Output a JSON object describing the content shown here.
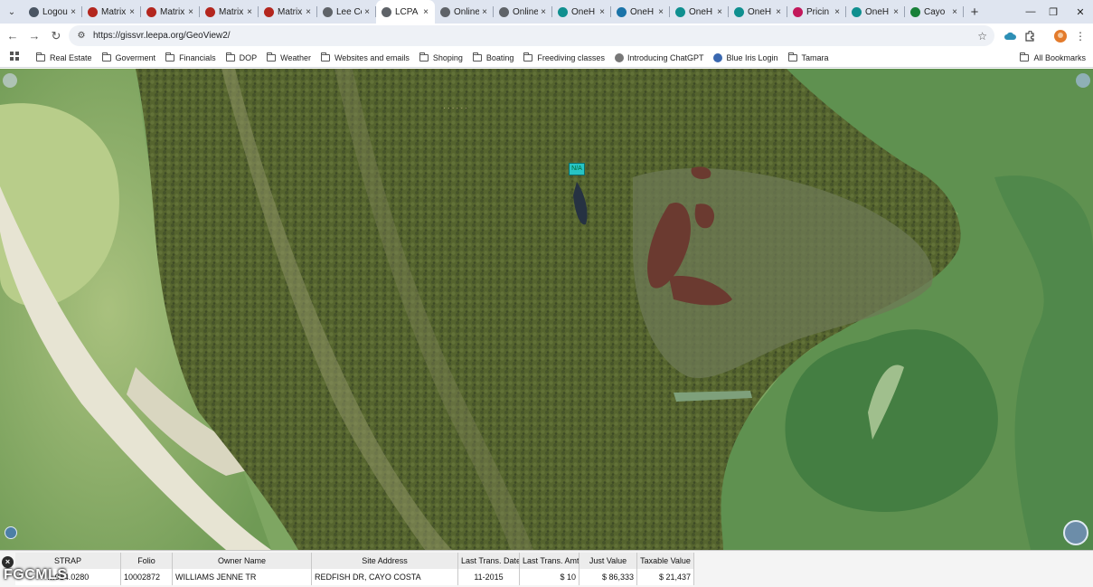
{
  "browser": {
    "tabs": [
      {
        "label": "Logou",
        "color": "#4a5563"
      },
      {
        "label": "Matrix",
        "color": "#b3261e"
      },
      {
        "label": "Matrix",
        "color": "#b3261e"
      },
      {
        "label": "Matrix",
        "color": "#b3261e"
      },
      {
        "label": "Matrix",
        "color": "#b3261e"
      },
      {
        "label": "Lee Co",
        "color": "#5f6368"
      },
      {
        "label": "LCPA",
        "color": "#5f6368",
        "active": true
      },
      {
        "label": "Online",
        "color": "#5f6368"
      },
      {
        "label": "Online",
        "color": "#5f6368"
      },
      {
        "label": "OneH",
        "color": "#0f8f8f"
      },
      {
        "label": "OneH",
        "color": "#1a73a8"
      },
      {
        "label": "OneH",
        "color": "#0f8f8f"
      },
      {
        "label": "OneH",
        "color": "#0f8f8f"
      },
      {
        "label": "Pricin",
        "color": "#c2185b"
      },
      {
        "label": "OneH",
        "color": "#0f8f8f"
      },
      {
        "label": "Cayo",
        "color": "#188038"
      }
    ],
    "close_glyph": "×",
    "new_tab_glyph": "+",
    "window_controls": {
      "minimize": "—",
      "restore": "❐",
      "close": "✕"
    },
    "url": "https://gissvr.leepa.org/GeoView2/"
  },
  "bookmarks": {
    "items": [
      "Real Estate",
      "Goverment",
      "Financials",
      "DOP",
      "Weather",
      "Websites and emails",
      "Shoping",
      "Boating",
      "Freediving classes",
      "Introducing ChatGPT",
      "Blue Iris Login",
      "Tamara"
    ],
    "all_label": "All Bookmarks"
  },
  "map": {
    "marker_label": "N/A",
    "colors": {
      "forest": "#56652f",
      "water_dark": "#3f7a40",
      "water_light": "#9fc07a",
      "sand": "#e7e4d3",
      "shallows": "#aac59a"
    }
  },
  "grid": {
    "close_glyph": "×",
    "headers": [
      "STRAP",
      "Folio",
      "Owner Name",
      "Site Address",
      "Last Trans. Date",
      "Last Trans. Amt",
      "Just Value",
      "Taxable Value"
    ],
    "row": {
      "strap": "…014.0280",
      "folio": "10002872",
      "owner": "WILLIAMS JENNE TR",
      "address": "REDFISH DR, CAYO COSTA",
      "date": "11-2015",
      "amount": "$ 10",
      "just_value": "$ 86,333",
      "taxable_value": "$ 21,437"
    }
  },
  "watermark": "FGCMLS"
}
